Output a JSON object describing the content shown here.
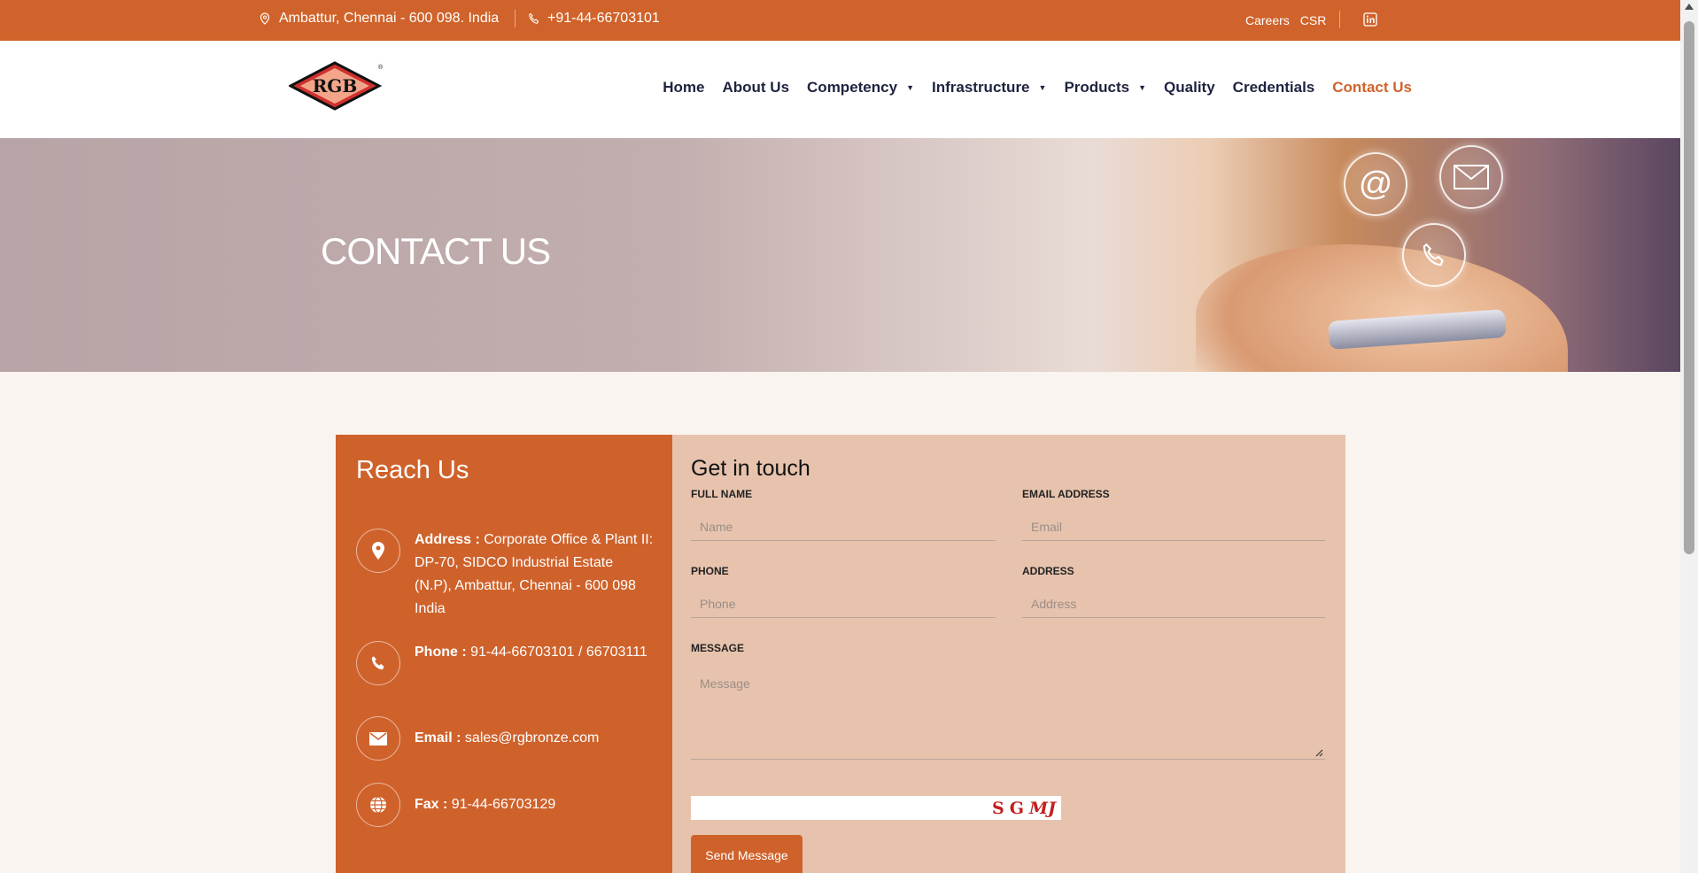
{
  "topbar": {
    "location": "Ambattur, Chennai - 600 098. India",
    "phone": "+91-44-66703101",
    "careers": "Careers",
    "csr": "CSR",
    "location_icon": "location-pin-icon",
    "phone_icon": "phone-icon",
    "social_icon": "linkedin-icon"
  },
  "logo": {
    "text": "RGB",
    "mark": "®"
  },
  "nav": {
    "items": [
      {
        "label": "Home",
        "dropdown": false
      },
      {
        "label": "About Us",
        "dropdown": false
      },
      {
        "label": "Competency",
        "dropdown": true
      },
      {
        "label": "Infrastructure",
        "dropdown": true
      },
      {
        "label": "Products",
        "dropdown": true
      },
      {
        "label": "Quality",
        "dropdown": false
      },
      {
        "label": "Credentials",
        "dropdown": false
      },
      {
        "label": "Contact Us",
        "dropdown": false,
        "active": true
      }
    ]
  },
  "hero": {
    "title": "CONTACT US",
    "icons": [
      "at-icon",
      "mail-icon",
      "phone-icon"
    ]
  },
  "reach": {
    "title": "Reach Us",
    "items": [
      {
        "icon": "location-pin-icon",
        "label": "Address :",
        "value": "Corporate Office & Plant II: DP-70, SIDCO Industrial Estate (N.P), Ambattur, Chennai - 600 098",
        "extra": "India"
      },
      {
        "icon": "phone-icon",
        "label": "Phone :",
        "value": "91-44-66703101 / 66703111"
      },
      {
        "icon": "envelope-icon",
        "label": "Email :",
        "value": "sales@rgbronze.com"
      },
      {
        "icon": "globe-icon",
        "label": "Fax :",
        "value": "91-44-66703129"
      }
    ]
  },
  "form": {
    "title": "Get in touch",
    "full_name_label": "FULL NAME",
    "full_name_placeholder": "Name",
    "email_label": "EMAIL ADDRESS",
    "email_placeholder": "Email",
    "phone_label": "PHONE",
    "phone_placeholder": "Phone",
    "address_label": "ADDRESS",
    "address_placeholder": "Address",
    "message_label": "MESSAGE",
    "message_placeholder": "Message",
    "captcha": [
      "S",
      "G",
      "MJ"
    ],
    "send_label": "Send Message"
  },
  "colors": {
    "accent": "#d0632b",
    "panel": "#e7c3ad",
    "page_bg": "#f9f4ef",
    "nav_text": "#1f2340"
  }
}
